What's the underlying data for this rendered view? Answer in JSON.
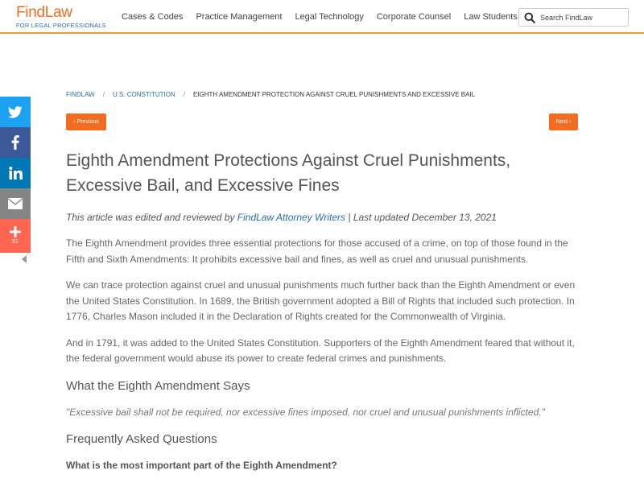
{
  "header": {
    "logo": "FindLaw",
    "logo_sub": "FOR LEGAL PROFESSIONALS",
    "nav": [
      {
        "label": "Cases & Codes"
      },
      {
        "label": "Practice Management"
      },
      {
        "label": "Legal Technology"
      },
      {
        "label": "Corporate Counsel"
      },
      {
        "label": "Law Students"
      }
    ],
    "search_placeholder": "Search FindLaw"
  },
  "social": {
    "buttons": [
      "twitter-icon",
      "facebook-icon",
      "linkedin-icon",
      "email-icon",
      "plus-icon"
    ],
    "share_count": "51"
  },
  "breadcrumb": {
    "items": [
      "FINDLAW",
      "U.S. CONSTITUTION"
    ],
    "current": "EIGHTH AMENDMENT PROTECTION AGAINST CRUEL PUNISHMENTS AND EXCESSIVE BAIL"
  },
  "pager": {
    "prev": "‹ Previous",
    "next": "Next ›"
  },
  "article": {
    "title": "Eighth Amendment Protections Against Cruel Punishments, Excessive Bail, and Excessive Fines",
    "byline_prefix": "This article was edited and reviewed by ",
    "byline_author": "FindLaw Attorney Writers",
    "byline_suffix": " | Last updated December 13, 2021",
    "paragraphs": [
      "The Eighth Amendment provides three essential protections for those accused of a crime, on top of those found in the Fifth and Sixth Amendments: It prohibits excessive bail and fines, as well as cruel and unusual punishments.",
      "We can trace protection against cruel and unusual punishments much further back than the Eighth Amendment or even the United States Constitution. In 1689, the British government adopted a Bill of Rights that included such protection. In 1776, Charles Mason included it in the Declaration of Rights created for the Commonwealth of Virginia.",
      "And in 1791, it was added to the United States Constitution. Supporters of the Eighth Amendment feared that without it, the federal government would abuse its power to create federal crimes and punishments."
    ],
    "section_heading": "What the Eighth Amendment Says",
    "quote": "\"Excessive bail shall not be required, nor excessive fines imposed, nor cruel and unusual punishments inflicted.\"",
    "faq_heading": "Frequently Asked Questions",
    "faq_question": "What is the most important part of the Eighth Amendment?"
  },
  "colors": {
    "accent": "#f26d21",
    "link": "#2a6ea6",
    "twitter": "#1da1f2",
    "facebook": "#3b5998",
    "linkedin": "#0077b5",
    "email": "#848484",
    "share": "#ff6550"
  }
}
